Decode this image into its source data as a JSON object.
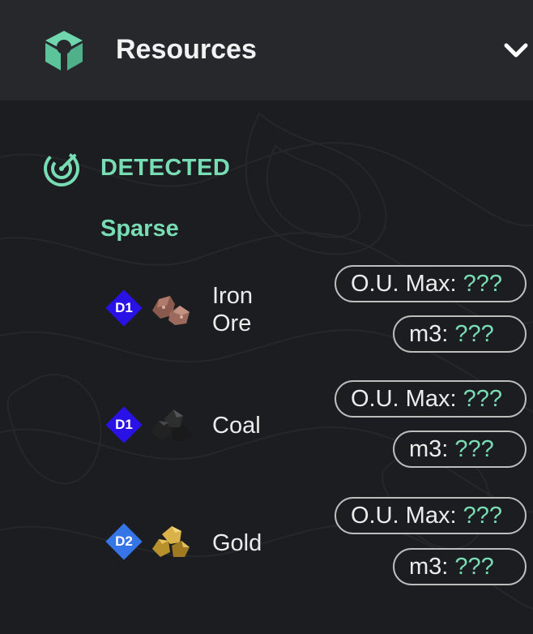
{
  "header": {
    "title": "Resources",
    "logo_icon": "resource-cube-icon",
    "toggle_icon": "chevron-down-icon"
  },
  "section": {
    "title": "DETECTED",
    "icon": "radar-icon",
    "accent_color": "#78dcb4"
  },
  "density_label": "Sparse",
  "resources": [
    {
      "tier": "D1",
      "tier_color": "#2a12e6",
      "name_line1": "Iron",
      "name_line2": "Ore",
      "ou_label": "O.U. Max:",
      "ou_value": "???",
      "m3_label": "m3:",
      "m3_value": "???",
      "icon": "iron-ore-icon"
    },
    {
      "tier": "D1",
      "tier_color": "#2a12e6",
      "name_line1": "Coal",
      "name_line2": "",
      "ou_label": "O.U. Max:",
      "ou_value": "???",
      "m3_label": "m3:",
      "m3_value": "???",
      "icon": "coal-icon"
    },
    {
      "tier": "D2",
      "tier_color": "#3575e8",
      "name_line1": "Gold",
      "name_line2": "",
      "ou_label": "O.U. Max:",
      "ou_value": "???",
      "m3_label": "m3:",
      "m3_value": "???",
      "icon": "gold-nugget-icon"
    }
  ]
}
